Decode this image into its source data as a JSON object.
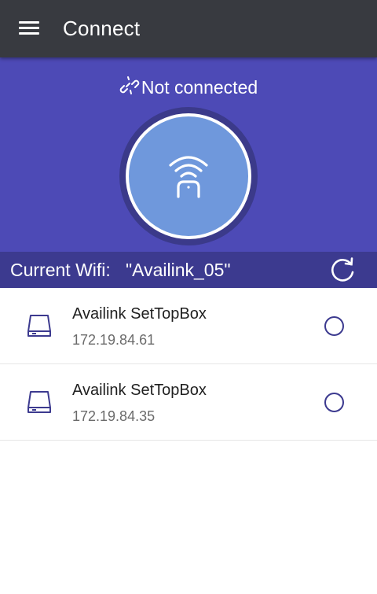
{
  "appbar": {
    "menu_icon": "hamburger-menu-icon",
    "title": "Connect"
  },
  "status": {
    "icon": "broken-link-icon",
    "text": "Not connected"
  },
  "connect_button": {
    "icon": "remote-wifi-icon"
  },
  "wifi": {
    "label": "Current Wifi:",
    "value": "\"Availink_05\"",
    "refresh_icon": "refresh-icon"
  },
  "devices": [
    {
      "name": "Availink SetTopBox",
      "ip": "172.19.84.61",
      "icon": "hard-drive-icon",
      "selected": false
    },
    {
      "name": "Availink SetTopBox",
      "ip": "172.19.84.35",
      "icon": "hard-drive-icon",
      "selected": false
    }
  ],
  "colors": {
    "appbar": "#383a40",
    "hero": "#4d4ab6",
    "wifi_bar": "#3c3a8f",
    "connect_button": "#6f98dc",
    "accent": "#3c3a8f"
  }
}
